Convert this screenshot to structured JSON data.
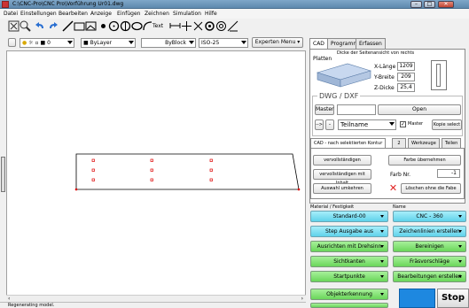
{
  "window": {
    "title": "C:\\CNC-Pro\\CNC Pro\\Vorführung Ur01.dwg",
    "controls": {
      "minimize": "–",
      "maximize": "□",
      "close": "✕"
    }
  },
  "menu": [
    "Datei",
    "Einstellungen",
    "Bearbeiten",
    "Anzeige",
    "Einfügen",
    "Zeichnen",
    "Simulation",
    "Hilfe"
  ],
  "toolbar2": {
    "layer_value": "0",
    "color_value": "ByLayer",
    "linetype_value": "ByBlock",
    "dimstyle_value": "ISO-25",
    "expert_mode_label": "Experten Menu"
  },
  "status": {
    "text": "Regenerating model."
  },
  "right_panel": {
    "tabs": [
      "CAD",
      "Programm",
      "Erfassen"
    ],
    "platten": {
      "label": "Platten",
      "subtitle": "Dicke der Seitenansicht von rechts",
      "x_label": "X-Länge",
      "x_value": "1209",
      "y_label": "Y-Breite",
      "y_value": "209",
      "z_label": "Z-Dicke",
      "z_value": "25,4"
    },
    "dwg_dxf": {
      "title": "DWG / DXF",
      "master_button": "Master",
      "open_button": "Open",
      "arrow_button": "-->",
      "dash_button": "-",
      "part_name_value": "Teilname",
      "master_checkbox_label": "Master",
      "copy_button": "Kopie select"
    },
    "contour_tabs": [
      "CAD - nach selektierten Kontur",
      "2",
      "Werkzeuge",
      "Teilen"
    ],
    "contour": {
      "complete_button": "vervollständigen",
      "color_take_button": "Farbe übernehmen",
      "complete_with_content_button": "vervollständigen mit Inhalt",
      "color_nr_label": "Farb Nr.",
      "color_nr_value": "-1",
      "invert_selection_button": "Auswahl umkehren",
      "delete_without_color_button": "Löschen ohne die Fabe"
    },
    "material_label": "Material / Festigkeit",
    "name_label": "Name",
    "rows": [
      {
        "left": "Standard-00",
        "right": "CNC - 360"
      },
      {
        "left": "Step Ausgabe aus",
        "right": "Zeichenlinien erstellen"
      },
      {
        "left": "Ausrichten mit Drehsinn",
        "right": "Bereinigen"
      },
      {
        "left": "Sichtkanten",
        "right": "Fräsvorschläge"
      },
      {
        "left": "Startpunkte",
        "right": "Bearbeitungen erstellen"
      }
    ],
    "object_recognition_button": "Objekterkennung",
    "stop_button": "Stop"
  }
}
